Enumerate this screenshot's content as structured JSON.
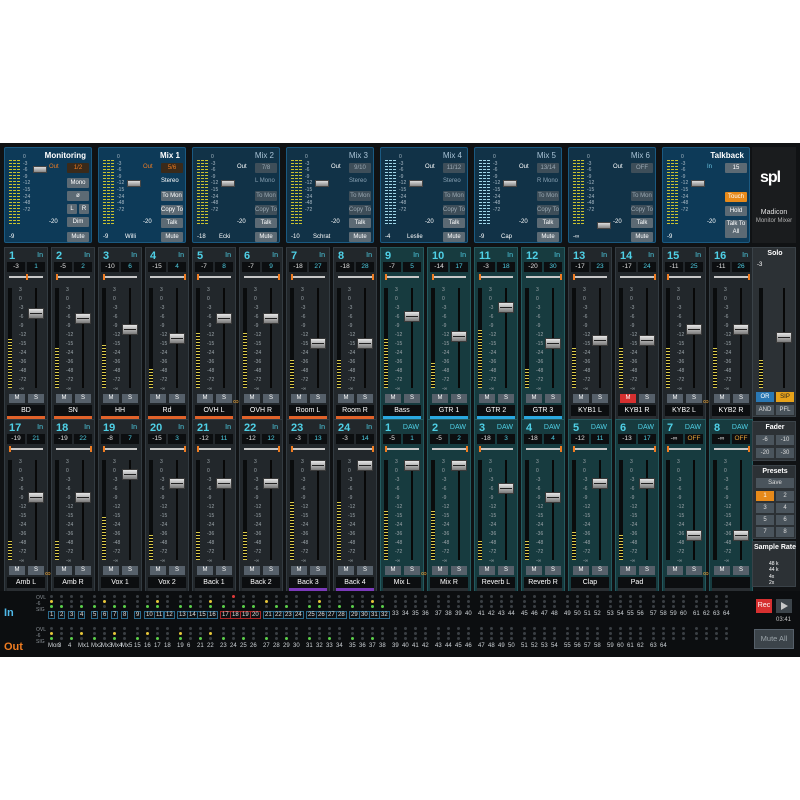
{
  "app": {
    "logo": "spl",
    "product": "Madicon",
    "subtitle": "Monitor Mixer"
  },
  "mixes": [
    {
      "title": "Monitoring",
      "active": true,
      "out_label": "Out",
      "out_value": "1/2",
      "buttons": [
        "Mono",
        "ø",
        "L",
        "R",
        "Dim",
        "Mute"
      ],
      "level": "-20",
      "bottom": "-9"
    },
    {
      "title": "Mix 1",
      "active": true,
      "out_label": "Out",
      "out_value": "5/6",
      "mode": "Stereo",
      "buttons": [
        "To Mon",
        "Copy To",
        "Talk",
        "Mute"
      ],
      "level": "-20",
      "bottom": "-9",
      "name": "Willi"
    },
    {
      "title": "Mix 2",
      "active": false,
      "out_label": "Out",
      "out_value": "7/8",
      "mode": "L Mono",
      "buttons": [
        "To Mon",
        "Copy To",
        "Talk",
        "Mute"
      ],
      "level": "-20",
      "bottom": "-18",
      "name": "Ecki"
    },
    {
      "title": "Mix 3",
      "active": false,
      "out_label": "Out",
      "out_value": "9/10",
      "mode": "Stereo",
      "buttons": [
        "To Mon",
        "Copy To",
        "Talk",
        "Mute"
      ],
      "level": "-20",
      "bottom": "-10",
      "name": "Schrat"
    },
    {
      "title": "Mix 4",
      "active": false,
      "out_label": "Out",
      "out_value": "11/12",
      "mode": "Stereo",
      "buttons": [
        "To Mon",
        "Copy To",
        "Talk",
        "Mute"
      ],
      "level": "-20",
      "bottom": "-4",
      "name": "Leslie"
    },
    {
      "title": "Mix 5",
      "active": false,
      "out_label": "Out",
      "out_value": "13/14",
      "mode": "R Mono",
      "buttons": [
        "To Mon",
        "Copy To",
        "Talk",
        "Mute"
      ],
      "level": "-20",
      "bottom": "-9",
      "name": "Cap"
    },
    {
      "title": "Mix 6",
      "active": false,
      "out_label": "Out",
      "out_value": "OFF",
      "mode": "",
      "buttons": [
        "To Mon",
        "Copy To",
        "Talk",
        "Mute"
      ],
      "level": "-20",
      "bottom": "-∞",
      "name": ""
    },
    {
      "title": "Talkback",
      "active": true,
      "out_label": "In",
      "out_value": "15",
      "buttons": [
        "Touch",
        "Hold",
        "Talk To All"
      ],
      "level": "-20",
      "bottom": "-9"
    }
  ],
  "scale_marks": [
    "3",
    "0",
    "-3",
    "-6",
    "-9",
    "-12",
    "-15",
    "-24",
    "-36",
    "-48",
    "-72",
    "-∞"
  ],
  "mini_marks": [
    "0",
    "-3",
    "-6",
    "-9",
    "-12",
    "-15",
    "-24",
    "-48",
    "-72"
  ],
  "ms": {
    "m": "M",
    "s": "S"
  },
  "channels_row1": [
    {
      "num": "1",
      "tag": "In",
      "peak": "-3",
      "gain": "1",
      "name": "BD",
      "color": "#e0622a",
      "teal": false
    },
    {
      "num": "2",
      "tag": "In",
      "peak": "-5",
      "gain": "2",
      "name": "SN",
      "color": "#e0622a",
      "teal": false
    },
    {
      "num": "3",
      "tag": "In",
      "peak": "-10",
      "gain": "6",
      "name": "HH",
      "color": "#e0622a",
      "teal": false
    },
    {
      "num": "4",
      "tag": "In",
      "peak": "-15",
      "gain": "4",
      "name": "Rd",
      "color": "#e0622a",
      "teal": false
    },
    {
      "num": "5",
      "tag": "In",
      "peak": "-7",
      "gain": "8",
      "name": "OVH L",
      "color": "#e0622a",
      "teal": false
    },
    {
      "num": "6",
      "tag": "In",
      "peak": "-7",
      "gain": "9",
      "name": "OVH R",
      "color": "#e0622a",
      "teal": false
    },
    {
      "num": "7",
      "tag": "In",
      "peak": "-18",
      "gain": "27",
      "name": "Room L",
      "color": "#e0622a",
      "teal": false
    },
    {
      "num": "8",
      "tag": "In",
      "peak": "-18",
      "gain": "28",
      "name": "Room R",
      "color": "#e0622a",
      "teal": false
    },
    {
      "num": "9",
      "tag": "In",
      "peak": "-7",
      "gain": "5",
      "name": "Bass",
      "color": "#2aa8e0",
      "teal": true
    },
    {
      "num": "10",
      "tag": "In",
      "peak": "-14",
      "gain": "17",
      "name": "GTR 1",
      "color": "#2aa8e0",
      "teal": true
    },
    {
      "num": "11",
      "tag": "In",
      "peak": "-3",
      "gain": "18",
      "name": "GTR 2",
      "color": "#2aa8e0",
      "teal": true
    },
    {
      "num": "12",
      "tag": "In",
      "peak": "-20",
      "gain": "30",
      "name": "GTR 3",
      "color": "#2aa8e0",
      "teal": true
    },
    {
      "num": "13",
      "tag": "In",
      "peak": "-17",
      "gain": "23",
      "name": "KYB1 L",
      "color": "#2a2e32",
      "teal": false
    },
    {
      "num": "14",
      "tag": "In",
      "peak": "-17",
      "gain": "24",
      "name": "KYB1 R",
      "color": "#2a2e32",
      "teal": false
    },
    {
      "num": "15",
      "tag": "In",
      "peak": "-11",
      "gain": "25",
      "name": "KYB2 L",
      "color": "#2a2e32",
      "teal": false
    },
    {
      "num": "16",
      "tag": "In",
      "peak": "-11",
      "gain": "26",
      "name": "KYB2 R",
      "color": "#2a2e32",
      "teal": false
    }
  ],
  "channels_row2": [
    {
      "num": "17",
      "tag": "In",
      "peak": "-19",
      "gain": "21",
      "name": "Amb L",
      "color": "#2a2e32",
      "teal": false
    },
    {
      "num": "18",
      "tag": "In",
      "peak": "-19",
      "gain": "22",
      "name": "Amb R",
      "color": "#2a2e32",
      "teal": false
    },
    {
      "num": "19",
      "tag": "In",
      "peak": "-8",
      "gain": "7",
      "name": "Vox 1",
      "color": "#2a2e32",
      "teal": false
    },
    {
      "num": "20",
      "tag": "In",
      "peak": "-15",
      "gain": "3",
      "name": "Vox 2",
      "color": "#2a2e32",
      "teal": false
    },
    {
      "num": "21",
      "tag": "In",
      "peak": "-12",
      "gain": "11",
      "name": "Back 1",
      "color": "#2a2e32",
      "teal": false
    },
    {
      "num": "22",
      "tag": "In",
      "peak": "-12",
      "gain": "12",
      "name": "Back 2",
      "color": "#2a2e32",
      "teal": false
    },
    {
      "num": "23",
      "tag": "In",
      "peak": "-3",
      "gain": "13",
      "name": "Back 3",
      "color": "#7a3ab8",
      "teal": false
    },
    {
      "num": "24",
      "tag": "In",
      "peak": "-3",
      "gain": "14",
      "name": "Back 4",
      "color": "#7a3ab8",
      "teal": false
    },
    {
      "num": "1",
      "tag": "DAW",
      "peak": "-5",
      "gain": "1",
      "name": "Mix L",
      "color": "#2a2e32",
      "teal": true
    },
    {
      "num": "2",
      "tag": "DAW",
      "peak": "-5",
      "gain": "2",
      "name": "Mix R",
      "color": "#2a2e32",
      "teal": true
    },
    {
      "num": "3",
      "tag": "DAW",
      "peak": "-18",
      "gain": "3",
      "name": "Reverb L",
      "color": "#2a2e32",
      "teal": true
    },
    {
      "num": "4",
      "tag": "DAW",
      "peak": "-18",
      "gain": "4",
      "name": "Reverb R",
      "color": "#2a2e32",
      "teal": true
    },
    {
      "num": "5",
      "tag": "DAW",
      "peak": "-12",
      "gain": "11",
      "name": "Clap",
      "color": "#2a2e32",
      "teal": true
    },
    {
      "num": "6",
      "tag": "DAW",
      "peak": "-13",
      "gain": "17",
      "name": "Pad",
      "color": "#2a2e32",
      "teal": true
    },
    {
      "num": "7",
      "tag": "DAW",
      "peak": "-∞",
      "gain": "OFF",
      "name": "",
      "color": "#2a2e32",
      "teal": true
    },
    {
      "num": "8",
      "tag": "DAW",
      "peak": "-∞",
      "gain": "OFF",
      "name": "",
      "color": "#2a2e32",
      "teal": true
    }
  ],
  "solo": {
    "title": "Solo",
    "value": "-3",
    "or": "OR",
    "sip": "SIP",
    "and": "AND",
    "pfl": "PFL"
  },
  "fader_panel": {
    "title": "Fader",
    "buttons": [
      "-6",
      "-10",
      "-20",
      "-30",
      "-40",
      "-∞"
    ]
  },
  "presets": {
    "title": "Presets",
    "save": "Save",
    "slots": [
      "1",
      "2",
      "3",
      "4",
      "5",
      "6",
      "7",
      "8"
    ]
  },
  "sample_rate": {
    "title": "Sample Rate",
    "rates": [
      "48 k",
      "44 k",
      "4x",
      "2x"
    ]
  },
  "io": {
    "in_label": "In",
    "out_label": "Out",
    "meter_labels": [
      "OVL",
      "-6",
      "SIG"
    ],
    "in_numbers": [
      "1",
      "2",
      "3",
      "4",
      "5",
      "6",
      "7",
      "8",
      "9",
      "10",
      "11",
      "12",
      "13",
      "14",
      "15",
      "16",
      "17",
      "18",
      "19",
      "20",
      "21",
      "22",
      "23",
      "24",
      "25",
      "26",
      "27",
      "28",
      "29",
      "30",
      "31",
      "32",
      "33",
      "34",
      "35",
      "36",
      "37",
      "38",
      "39",
      "40",
      "41",
      "42",
      "43",
      "44",
      "45",
      "46",
      "47",
      "48",
      "49",
      "50",
      "51",
      "52",
      "53",
      "54",
      "55",
      "56",
      "57",
      "58",
      "59",
      "60",
      "61",
      "62",
      "63",
      "64"
    ],
    "out_numbers": [
      "Mon",
      "3",
      "4",
      "Mx1",
      "Mx2",
      "Mx3",
      "Mx4",
      "Mx5",
      "15",
      "16",
      "17",
      "18",
      "19",
      "6",
      "21",
      "22",
      "23",
      "24",
      "25",
      "26",
      "27",
      "28",
      "29",
      "30",
      "31",
      "32",
      "33",
      "34",
      "35",
      "36",
      "37",
      "38",
      "39",
      "40",
      "41",
      "42",
      "43",
      "44",
      "45",
      "46",
      "47",
      "48",
      "49",
      "50",
      "51",
      "52",
      "53",
      "54",
      "55",
      "56",
      "57",
      "58",
      "59",
      "60",
      "61",
      "62",
      "63",
      "64"
    ],
    "rec": "Rec",
    "time": "03:41",
    "mute_all": "Mute All"
  }
}
